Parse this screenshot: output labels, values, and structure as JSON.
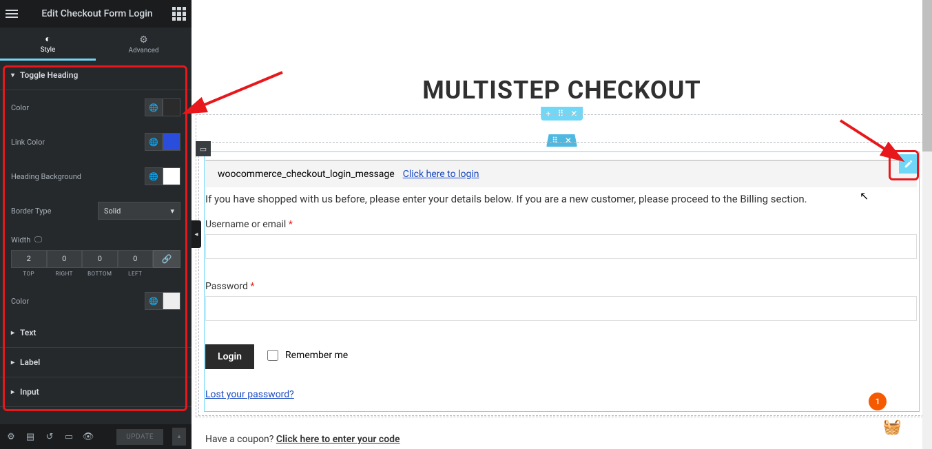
{
  "sidebar": {
    "title": "Edit Checkout Form Login",
    "tabs": {
      "style": "Style",
      "advanced": "Advanced"
    },
    "sections": {
      "toggle_heading": "Toggle Heading",
      "text": "Text",
      "label": "Label",
      "input": "Input"
    },
    "controls": {
      "color": "Color",
      "link_color": "Link Color",
      "heading_background": "Heading Background",
      "border_type": "Border Type",
      "border_type_value": "Solid",
      "width": "Width",
      "width_values": {
        "top": "2",
        "right": "0",
        "bottom": "0",
        "left": "0"
      },
      "width_labels": {
        "top": "TOP",
        "right": "RIGHT",
        "bottom": "BOTTOM",
        "left": "LEFT"
      },
      "color2": "Color"
    },
    "colors": {
      "link_color_swatch": "#2b4ddb",
      "heading_bg_swatch": "#ffffff",
      "color2_swatch": "#eeeeee",
      "color_swatch": "#2b2b2b"
    },
    "footer": {
      "update": "UPDATE"
    }
  },
  "canvas": {
    "title": "MULTISTEP CHECKOUT",
    "message_key": "woocommerce_checkout_login_message",
    "login_link": "Click here to login",
    "info": "If you have shopped with us before, please enter your details below. If you are a new customer, please proceed to the Billing section.",
    "username_label": "Username or email",
    "password_label": "Password",
    "login_button": "Login",
    "remember": "Remember me",
    "lost_password": "Lost your password?",
    "coupon_prompt": "Have a coupon?",
    "coupon_link": "Click here to enter your code",
    "badge": "1"
  }
}
